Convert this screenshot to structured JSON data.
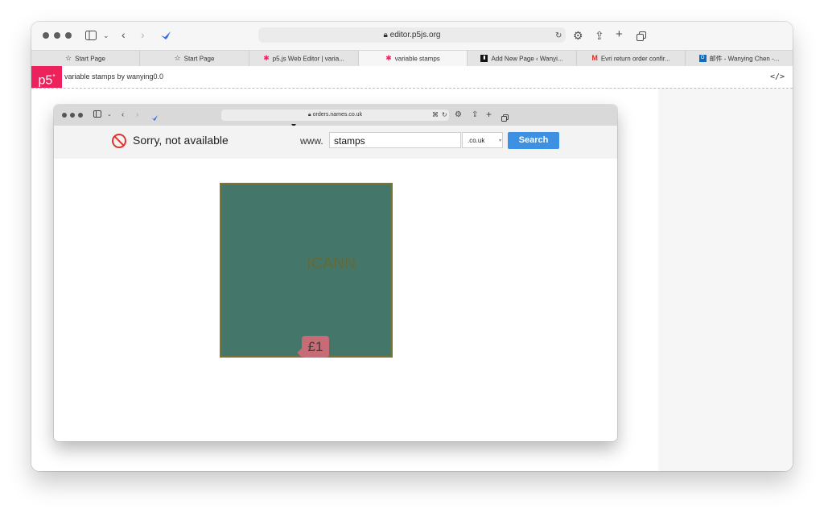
{
  "outer_browser": {
    "address": "editor.p5js.org",
    "tabs": [
      {
        "label": "Start Page",
        "icon": "star-outline-icon"
      },
      {
        "label": "Start Page",
        "icon": "star-outline-icon"
      },
      {
        "label": "p5.js Web Editor | varia...",
        "icon": "p5-asterisk-icon"
      },
      {
        "label": "variable stamps",
        "icon": "p5-asterisk-icon",
        "active": true
      },
      {
        "label": "Add New Page ‹ Wanyi...",
        "icon": "wordpress-icon"
      },
      {
        "label": "Evri return order confir...",
        "icon": "gmail-icon"
      },
      {
        "label": "邮件 - Wanying Chen -...",
        "icon": "outlook-icon"
      }
    ]
  },
  "p5_editor": {
    "logo": "p5",
    "logo_sup": "*",
    "sketch_title": "variable stamps by wanying0.0",
    "code_toggle": "</>"
  },
  "inner_browser": {
    "address": "orders.names.co.uk"
  },
  "domain_search": {
    "status_text": "Sorry, not available",
    "www_label": "www.",
    "query": "stamps",
    "tld": ".co.uk",
    "search_label": "Search"
  },
  "stamp": {
    "label": "ICANN",
    "price": "£1",
    "colors": {
      "background": "#44766a",
      "border": "#7a7536",
      "price_tag": "#c76b77"
    }
  }
}
